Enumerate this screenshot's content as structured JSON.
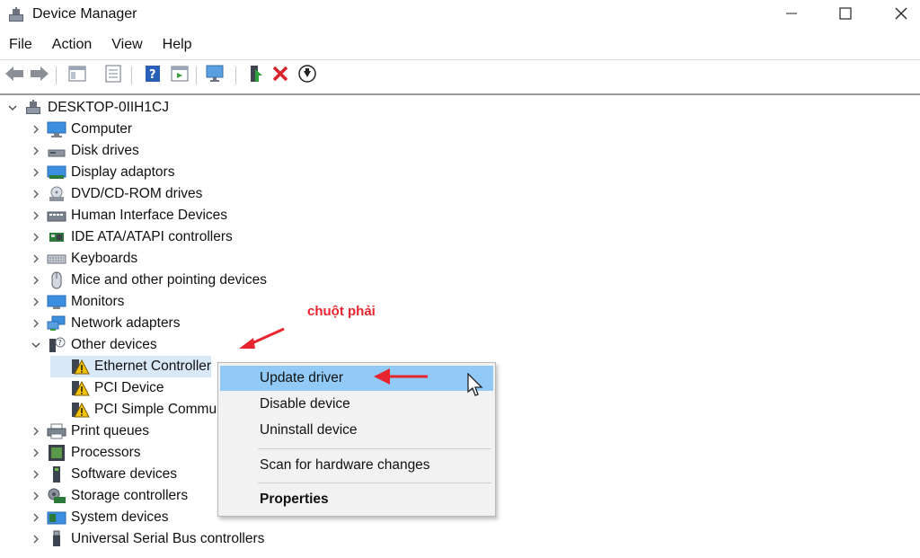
{
  "window": {
    "title": "Device Manager",
    "controls": {
      "minimize": "minimize-icon",
      "maximize": "maximize-icon",
      "close": "close-icon"
    }
  },
  "menubar": {
    "items": [
      "File",
      "Action",
      "View",
      "Help"
    ]
  },
  "toolbar": {
    "icons": [
      "back-arrow-icon",
      "forward-arrow-icon",
      "show-hide-console-tree-icon",
      "properties-icon",
      "help-icon",
      "show-action-pane-icon",
      "scan-hardware-icon",
      "update-driver-icon",
      "uninstall-device-icon",
      "enable-device-icon"
    ]
  },
  "tree": {
    "root": "DESKTOP-0IIH1CJ",
    "categories": [
      {
        "label": "Computer",
        "icon": "computer-icon",
        "expanded": false
      },
      {
        "label": "Disk drives",
        "icon": "disk-drive-icon",
        "expanded": false
      },
      {
        "label": "Display adaptors",
        "icon": "display-adapter-icon",
        "expanded": false
      },
      {
        "label": "DVD/CD-ROM drives",
        "icon": "dvd-drive-icon",
        "expanded": false
      },
      {
        "label": "Human Interface Devices",
        "icon": "hid-icon",
        "expanded": false
      },
      {
        "label": "IDE ATA/ATAPI controllers",
        "icon": "ide-controller-icon",
        "expanded": false
      },
      {
        "label": "Keyboards",
        "icon": "keyboard-icon",
        "expanded": false
      },
      {
        "label": "Mice and other pointing devices",
        "icon": "mouse-icon",
        "expanded": false
      },
      {
        "label": "Monitors",
        "icon": "monitor-icon",
        "expanded": false
      },
      {
        "label": "Network adapters",
        "icon": "network-adapter-icon",
        "expanded": false
      },
      {
        "label": "Other devices",
        "icon": "other-devices-icon",
        "expanded": true,
        "children": [
          "Ethernet Controller",
          "PCI Device",
          "PCI Simple Commu"
        ]
      },
      {
        "label": "Print queues",
        "icon": "printer-icon",
        "expanded": false
      },
      {
        "label": "Processors",
        "icon": "processor-icon",
        "expanded": false
      },
      {
        "label": "Software devices",
        "icon": "software-device-icon",
        "expanded": false
      },
      {
        "label": "Storage controllers",
        "icon": "storage-controller-icon",
        "expanded": false
      },
      {
        "label": "System devices",
        "icon": "system-device-icon",
        "expanded": false
      },
      {
        "label": "Universal Serial Bus controllers",
        "icon": "usb-icon",
        "expanded": false
      }
    ]
  },
  "context_menu": {
    "items": [
      "Update driver",
      "Disable device",
      "Uninstall device",
      "Scan for hardware changes",
      "Properties"
    ],
    "highlighted": "Update driver"
  },
  "annotation": {
    "text": "chuột phải",
    "color": "#e8242e"
  },
  "colors": {
    "highlight": "#91c9f7",
    "menu_bg": "#f2f2f2",
    "accent_red": "#e8242e"
  }
}
